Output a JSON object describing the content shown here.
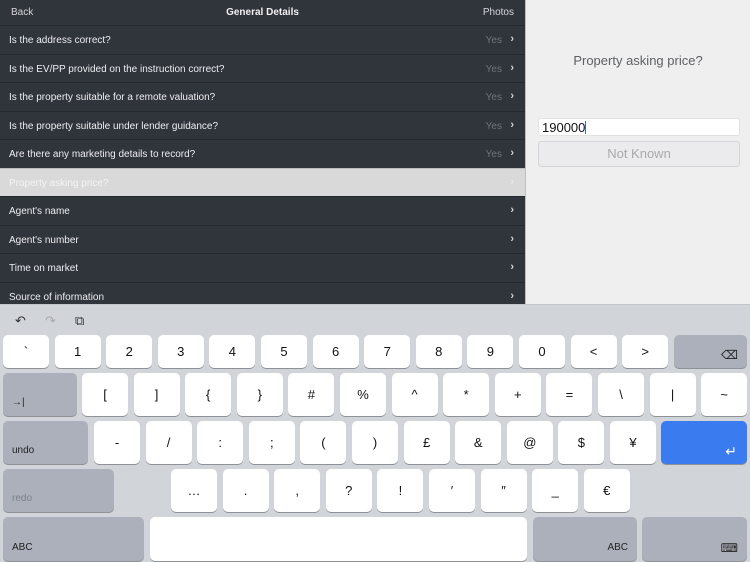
{
  "navbar": {
    "back_label": "Back",
    "title": "General Details",
    "photos_label": "Photos"
  },
  "questions": [
    {
      "label": "Is the address correct?",
      "value": "Yes"
    },
    {
      "label": "Is the EV/PP provided on the instruction correct?",
      "value": "Yes"
    },
    {
      "label": "Is the property suitable for a remote valuation?",
      "value": "Yes"
    },
    {
      "label": "Is the property suitable under lender guidance?",
      "value": "Yes"
    },
    {
      "label": "Are there any marketing details to record?",
      "value": "Yes"
    },
    {
      "label": "Property asking price?",
      "value": "",
      "selected": true
    },
    {
      "label": "Agent's name",
      "value": ""
    },
    {
      "label": "Agent's number",
      "value": ""
    },
    {
      "label": "Time on market",
      "value": ""
    },
    {
      "label": "Source of information",
      "value": ""
    }
  ],
  "detail": {
    "question": "Property asking price?",
    "input_value": "190000",
    "not_known_label": "Not Known"
  },
  "keyboard": {
    "toolbar": {
      "undo_icon": "↶",
      "redo_icon": "↷",
      "paste_icon": "⧉"
    },
    "row1": [
      "`",
      "1",
      "2",
      "3",
      "4",
      "5",
      "6",
      "7",
      "8",
      "9",
      "0",
      "<",
      ">"
    ],
    "row2": [
      "[",
      "]",
      "{",
      "}",
      "#",
      "%",
      "^",
      "*",
      "+",
      "=",
      "\\",
      "|",
      "~"
    ],
    "row3": [
      "-",
      "/",
      ":",
      ";",
      "(",
      ")",
      "£",
      "&",
      "@",
      "$",
      "¥"
    ],
    "row4": [
      "…",
      ".",
      ",",
      "?",
      "!",
      "′",
      "″",
      "_",
      "€"
    ],
    "tab_icon": "→|",
    "delete_icon": "⌫",
    "return_icon": "↵",
    "undo_label": "undo",
    "redo_label": "redo",
    "abc_left_label": "ABC",
    "abc_right_label": "ABC",
    "hide_keyboard_icon": "⌨"
  },
  "colors": {
    "left_panel_bg": "#30343b",
    "selected_row_bg": "#d9d9d9",
    "right_panel_bg": "#efefef",
    "keyboard_bg": "#d1d4d9",
    "return_key": "#3a7bf0"
  }
}
